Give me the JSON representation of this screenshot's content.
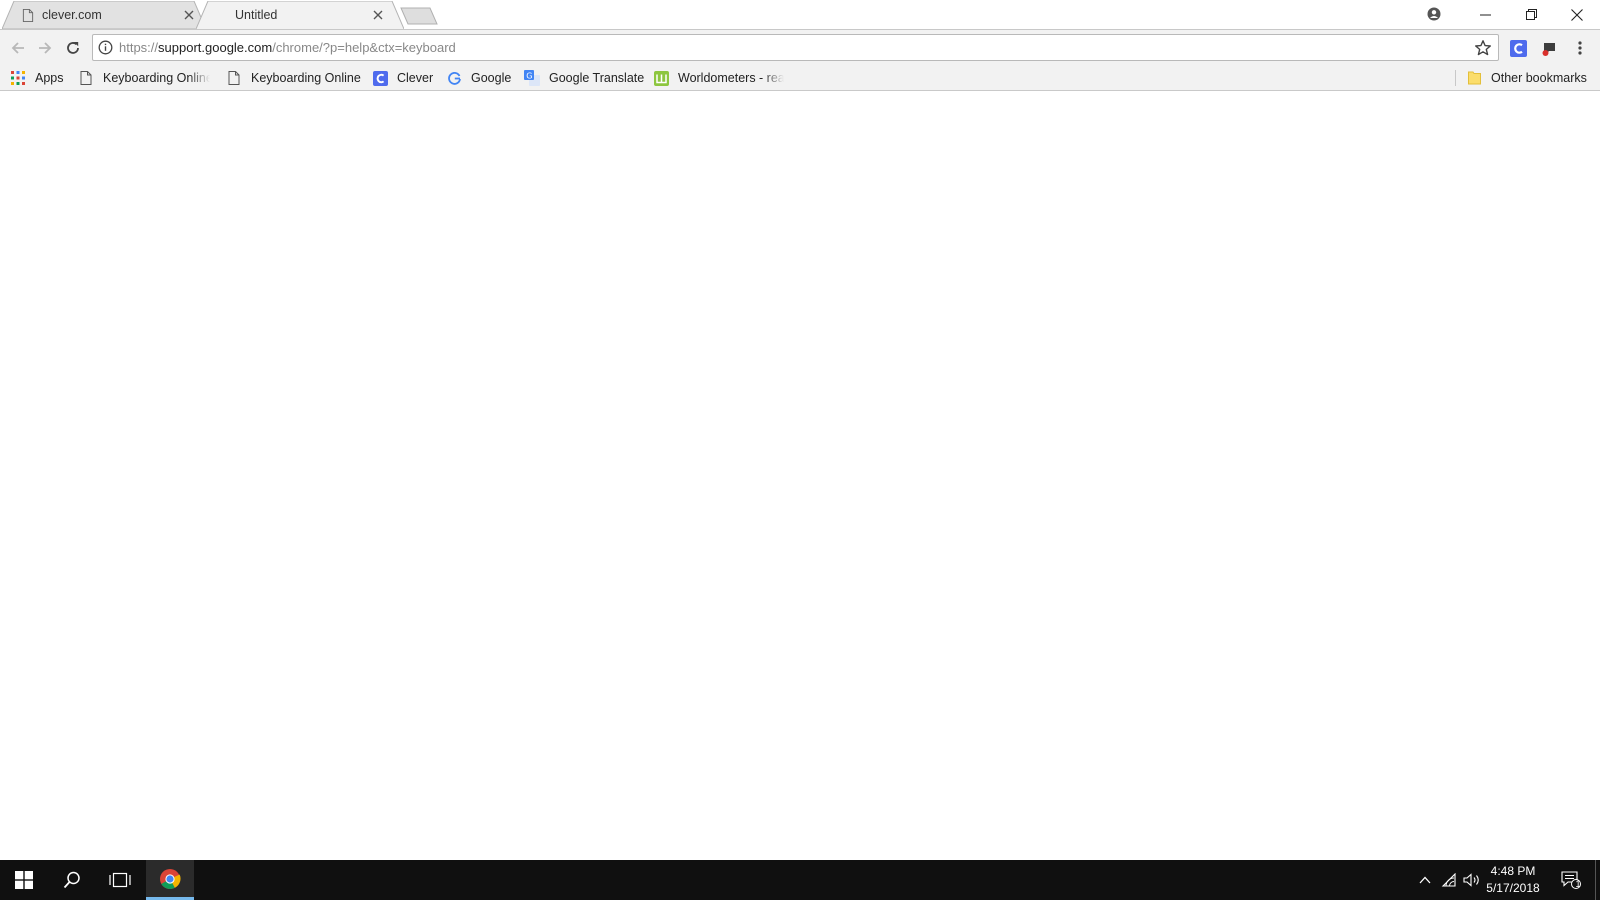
{
  "tabs": [
    {
      "title": "clever.com",
      "active": false
    },
    {
      "title": "Untitled",
      "active": true
    }
  ],
  "omnibox": {
    "scheme": "https://",
    "host": "support.google.com",
    "path": "/chrome/?p=help&ctx=keyboard"
  },
  "bookmarks": [
    {
      "label": "Apps",
      "icon": "apps-grid-icon"
    },
    {
      "label": "Keyboarding Online",
      "icon": "page-icon"
    },
    {
      "label": "Keyboarding Online",
      "icon": "page-icon"
    },
    {
      "label": "Clever",
      "icon": "clever-icon"
    },
    {
      "label": "Google",
      "icon": "google-icon"
    },
    {
      "label": "Google Translate",
      "icon": "google-translate-icon"
    },
    {
      "label": "Worldometers - real",
      "icon": "worldometers-icon"
    }
  ],
  "other_bookmarks": {
    "label": "Other bookmarks",
    "icon": "folder-icon"
  },
  "taskbar": {
    "time": "4:48 PM",
    "date": "5/17/2018",
    "notification_count": "1"
  },
  "colors": {
    "clever_blue": "#4f6bed",
    "taskbar": "#101010",
    "toolbar": "#f2f2f2"
  }
}
